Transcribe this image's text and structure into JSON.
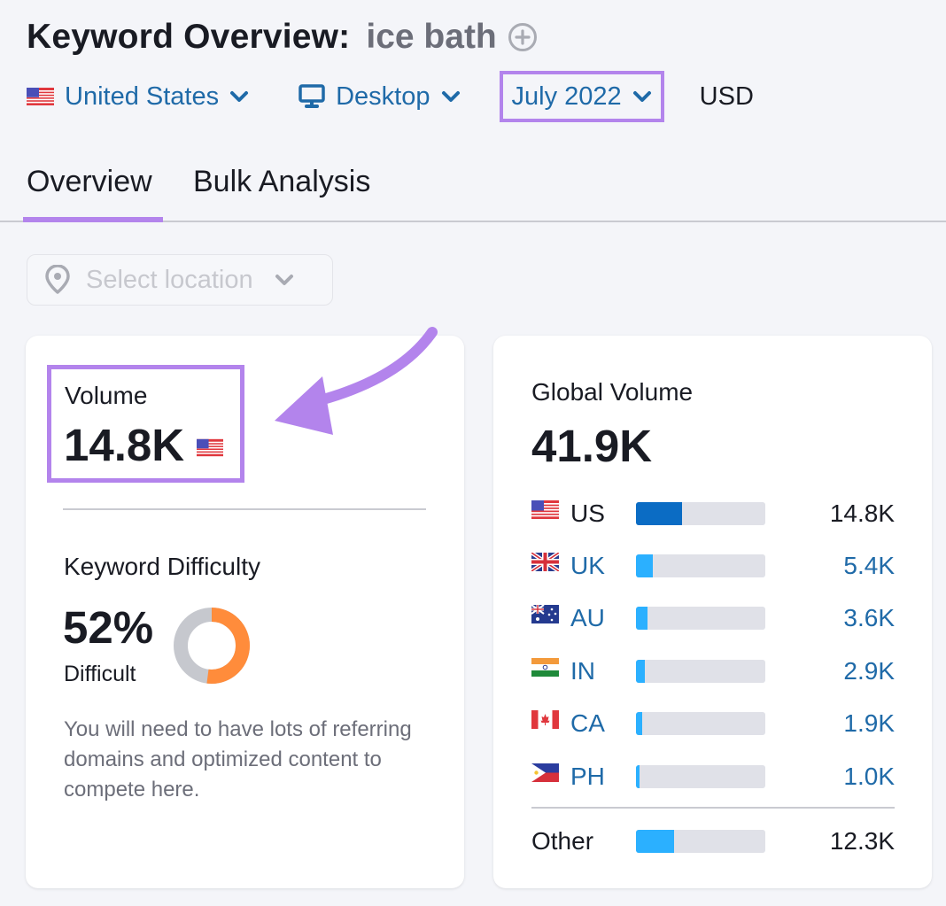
{
  "header": {
    "title": "Keyword Overview:",
    "keyword": "ice bath",
    "add_icon": "plus-circle-icon"
  },
  "filters": {
    "country": "United States",
    "country_flag": "us-flag-icon",
    "device": "Desktop",
    "device_icon": "monitor-icon",
    "date": "July 2022",
    "currency": "USD"
  },
  "tabs": [
    {
      "label": "Overview",
      "active": true
    },
    {
      "label": "Bulk Analysis",
      "active": false
    }
  ],
  "location_select": {
    "placeholder": "Select location",
    "icon": "location-pin-icon",
    "disabled": true
  },
  "volume_card": {
    "volume_label": "Volume",
    "volume_value": "14.8K",
    "volume_flag": "us-flag-icon",
    "kd_label": "Keyword Difficulty",
    "kd_value": "52%",
    "kd_percent": 52,
    "kd_level": "Difficult",
    "kd_description": "You will need to have lots of referring domains and optimized content to compete here.",
    "colors": {
      "kd_fill": "#ff8c3b",
      "kd_track": "#c6c8ce",
      "highlight": "#b384ec"
    }
  },
  "global_card": {
    "label": "Global Volume",
    "value": "41.9K",
    "countries": [
      {
        "code": "US",
        "flag": "us-flag-icon",
        "value": "14.8K",
        "share": 0.353,
        "linked": false
      },
      {
        "code": "UK",
        "flag": "uk-flag-icon",
        "value": "5.4K",
        "share": 0.129,
        "linked": true
      },
      {
        "code": "AU",
        "flag": "au-flag-icon",
        "value": "3.6K",
        "share": 0.086,
        "linked": true
      },
      {
        "code": "IN",
        "flag": "in-flag-icon",
        "value": "2.9K",
        "share": 0.069,
        "linked": true
      },
      {
        "code": "CA",
        "flag": "ca-flag-icon",
        "value": "1.9K",
        "share": 0.045,
        "linked": true
      },
      {
        "code": "PH",
        "flag": "ph-flag-icon",
        "value": "1.0K",
        "share": 0.024,
        "linked": true
      }
    ],
    "other": {
      "label": "Other",
      "value": "12.3K",
      "share": 0.294
    },
    "colors": {
      "primary_bar": "#0b6cc4",
      "secondary_bar": "#2bb0ff",
      "track": "#e0e1e8",
      "link": "#1f6aa8"
    }
  }
}
